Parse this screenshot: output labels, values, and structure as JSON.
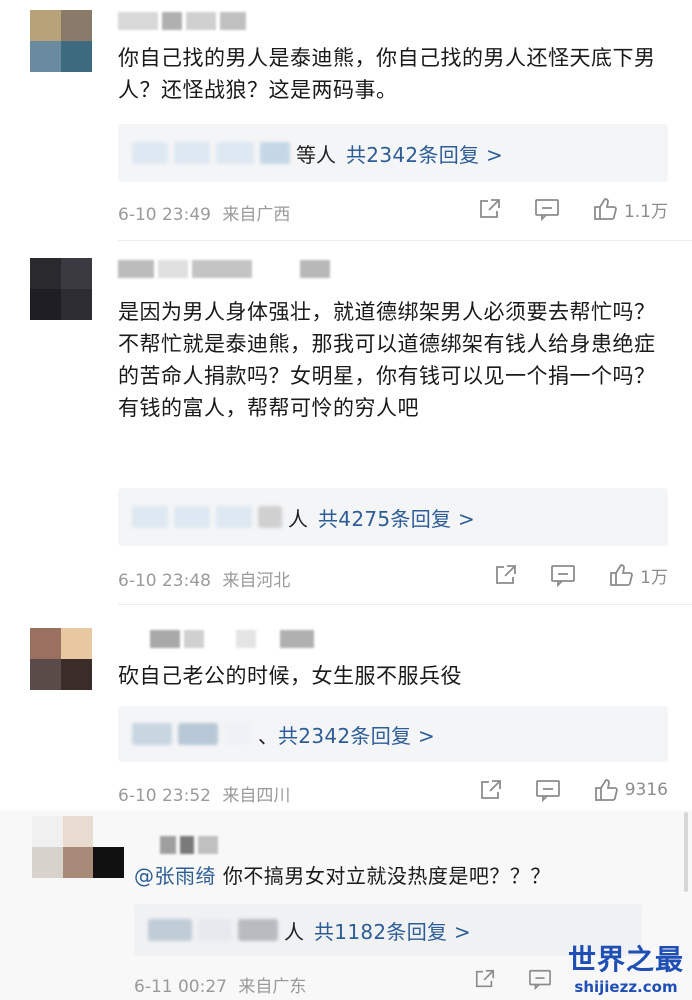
{
  "comments": [
    {
      "text": "你自己找的男人是泰迪熊，你自己找的男人还怪天底下男人？还怪战狼？这是两码事。",
      "replies": {
        "prefix": "等人",
        "tail": "共2342条回复 >"
      },
      "time": "6-10 23:49",
      "location": "来自广西",
      "likes": "1.1万"
    },
    {
      "text": "是因为男人身体强壮，就道德绑架男人必须要去帮忙吗？不帮忙就是泰迪熊，那我可以道德绑架有钱人给身患绝症的苦命人捐款吗？女明星，你有钱可以见一个捐一个吗？有钱的富人，帮帮可怜的穷人吧",
      "replies": {
        "prefix": "人",
        "tail": "共4275条回复 >"
      },
      "time": "6-10 23:48",
      "location": "来自河北",
      "likes": "1万"
    },
    {
      "text": "砍自己老公的时候，女生服不服兵役",
      "replies": {
        "prefix": "、",
        "tail": "共2342条回复 >"
      },
      "time": "6-10 23:52",
      "location": "来自四川",
      "likes": "9316"
    },
    {
      "mention": "@张雨绮",
      "text": " 你不搞男女对立就没热度是吧？？？",
      "replies": {
        "prefix": "人",
        "tail": "共1182条回复 >"
      },
      "time": "6-11 00:27",
      "location": "来自广东",
      "likes": ""
    }
  ],
  "watermark": {
    "cn": "世界之最",
    "en": "shijiezz.com"
  },
  "colors": {
    "link": "#2d5d94",
    "meta": "#9a9a9a",
    "reply_bg": "#f4f5f7",
    "watermark": "#1f4fb4"
  },
  "icons": [
    "share-icon",
    "comment-icon",
    "like-icon"
  ]
}
